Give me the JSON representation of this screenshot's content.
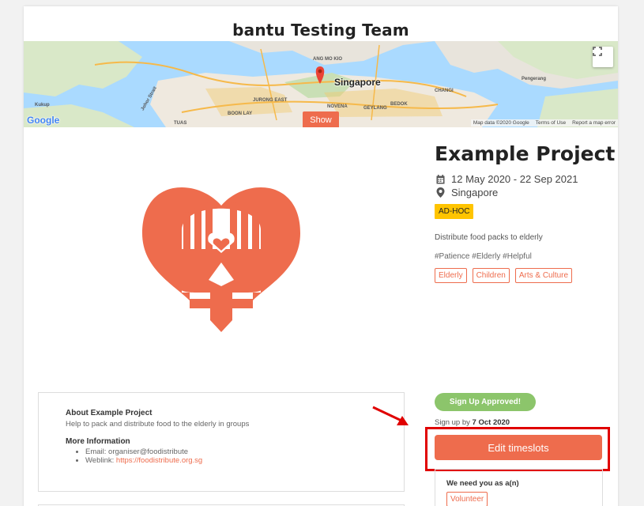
{
  "team": {
    "title": "bantu Testing Team"
  },
  "map": {
    "city_label": "Singapore",
    "show_label": "Show",
    "google_label": "Google",
    "attribution": [
      "Map data ©2020 Google",
      "Terms of Use",
      "Report a map error"
    ],
    "place_labels": [
      "Kukup",
      "Johor Strait",
      "BOON LAY",
      "JURONG EAST",
      "NOVENA",
      "GEYLANG",
      "BEDOK",
      "CHANGI",
      "Pengerang",
      "TUAS",
      "ANG MO KIO"
    ]
  },
  "project": {
    "title": "Example Project",
    "dates": "12 May 2020 - 22 Sep 2021",
    "location": "Singapore",
    "badge": "AD-HOC",
    "description": "Distribute food packs to elderly",
    "hashtags": "#Patience #Elderly #Helpful",
    "tags": [
      "Elderly",
      "Children",
      "Arts & Culture"
    ]
  },
  "about": {
    "title": "About Example Project",
    "text": "Help to pack and distribute food to the elderly in groups",
    "more_title": "More Information",
    "email_label": "Email: organiser@foodistribute",
    "weblink_label": "Weblink: ",
    "weblink_url": "https://foodistribute.org.sg"
  },
  "signup": {
    "status": "Sign Up Approved!",
    "by_label": "Sign up by ",
    "by_date": "7 Oct 2020",
    "edit_button": "Edit timeslots"
  },
  "needs": {
    "title": "We need you as a(n)",
    "role": "Volunteer"
  },
  "colors": {
    "accent": "#ee6c4d",
    "approved": "#8cc56b",
    "badge": "#ffc400",
    "highlight": "#e00000"
  }
}
